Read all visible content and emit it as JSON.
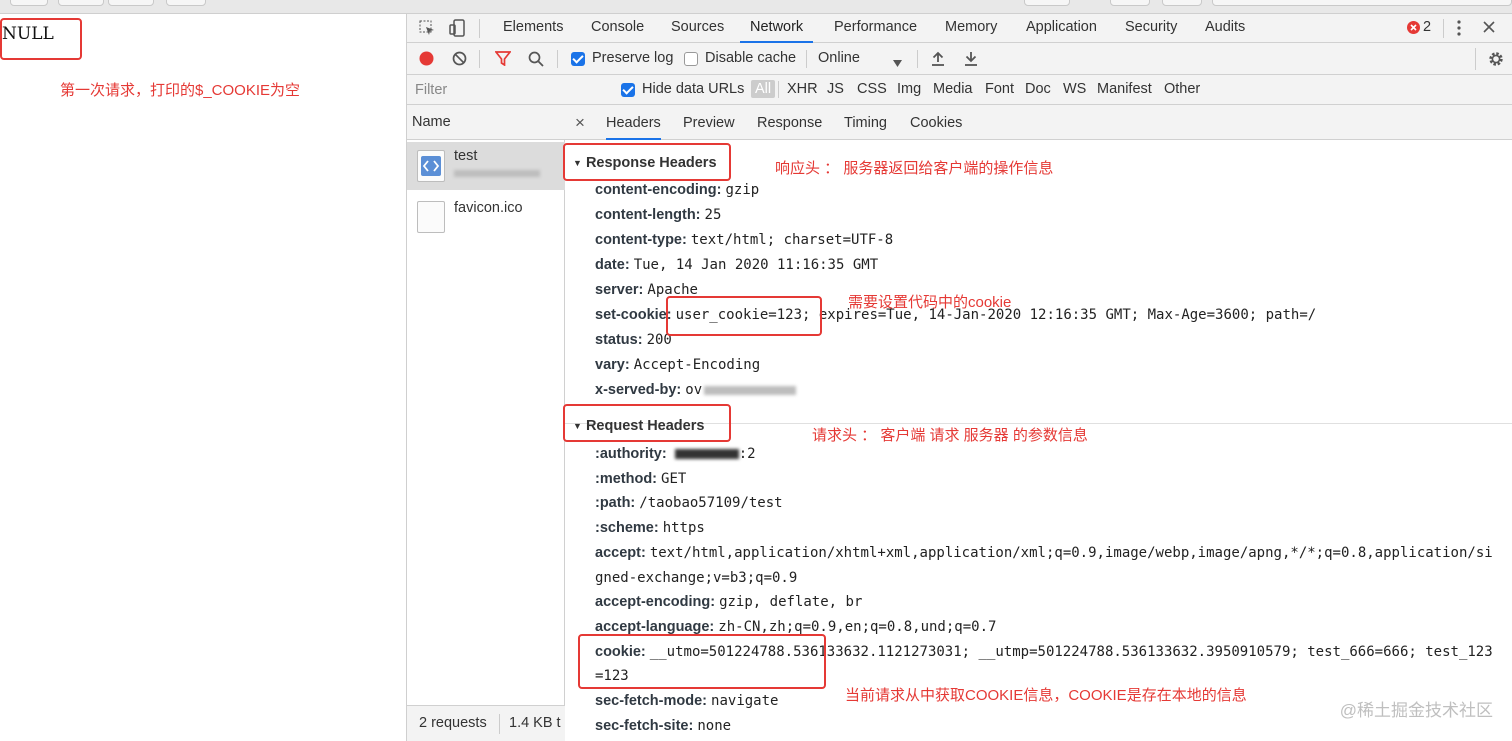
{
  "page": {
    "null_text": "NULL",
    "anno_first_request": "第一次请求，打印的$_COOKIE为空"
  },
  "tabs": [
    "Elements",
    "Console",
    "Sources",
    "Network",
    "Performance",
    "Memory",
    "Application",
    "Security",
    "Audits"
  ],
  "tabs_active": "Network",
  "error_count": "2",
  "toolbar": {
    "preserve_log": "Preserve log",
    "disable_cache": "Disable cache",
    "throttle": "Online"
  },
  "filterbar": {
    "placeholder": "Filter",
    "hide_data_urls": "Hide data URLs",
    "types": [
      "All",
      "XHR",
      "JS",
      "CSS",
      "Img",
      "Media",
      "Font",
      "Doc",
      "WS",
      "Manifest",
      "Other"
    ]
  },
  "list": {
    "header": "Name",
    "items": [
      "test",
      "favicon.ico"
    ],
    "footer_requests": "2 requests",
    "footer_size": "1.4 KB t"
  },
  "detail_tabs": [
    "Headers",
    "Preview",
    "Response",
    "Timing",
    "Cookies"
  ],
  "close_symbol": "×",
  "response": {
    "title": "Response Headers",
    "rows": [
      {
        "k": "content-encoding:",
        "v": "gzip"
      },
      {
        "k": "content-length:",
        "v": "25"
      },
      {
        "k": "content-type:",
        "v": "text/html; charset=UTF-8"
      },
      {
        "k": "date:",
        "v": "Tue, 14 Jan 2020 11:16:35 GMT"
      },
      {
        "k": "server:",
        "v": "Apache"
      },
      {
        "k": "set-cookie:",
        "v": "user_cookie=123; expires=Tue, 14-Jan-2020 12:16:35 GMT; Max-Age=3600; path=/"
      },
      {
        "k": "status:",
        "v": "200"
      },
      {
        "k": "vary:",
        "v": "Accept-Encoding"
      },
      {
        "k": "x-served-by:",
        "v": "ov"
      }
    ]
  },
  "request": {
    "title": "Request Headers",
    "rows": [
      {
        "k": ":authority:",
        "v": ":2"
      },
      {
        "k": ":method:",
        "v": "GET"
      },
      {
        "k": ":path:",
        "v": "/taobao57109/test"
      },
      {
        "k": ":scheme:",
        "v": "https"
      },
      {
        "k": "accept:",
        "v": "text/html,application/xhtml+xml,application/xml;q=0.9,image/webp,image/apng,*/*;q=0.8,application/si"
      },
      {
        "k": "",
        "v": "gned-exchange;v=b3;q=0.9"
      },
      {
        "k": "accept-encoding:",
        "v": "gzip, deflate, br"
      },
      {
        "k": "accept-language:",
        "v": "zh-CN,zh;q=0.9,en;q=0.8,und;q=0.7"
      },
      {
        "k": "cookie:",
        "v": "__utmo=501224788.536133632.1121273031; __utmp=501224788.536133632.3950910579; test_666=666; test_123"
      },
      {
        "k": "",
        "v": "=123"
      },
      {
        "k": "sec-fetch-mode:",
        "v": "navigate"
      },
      {
        "k": "sec-fetch-site:",
        "v": "none"
      }
    ]
  },
  "annotations": {
    "response_headers": "响应头 ：  服务器返回给客户端的操作信息",
    "set_cookie": "需要设置代码中的cookie",
    "request_headers": "请求头 ：  客户端 请求  服务器  的参数信息",
    "cookie": "当前请求从中获取COOKIE信息，COOKIE是存在本地的信息"
  },
  "watermark": "@稀土掘金技术社区",
  "colors": {
    "annotation": "#e53935",
    "accent": "#1a73e8",
    "record": "#e53935"
  }
}
